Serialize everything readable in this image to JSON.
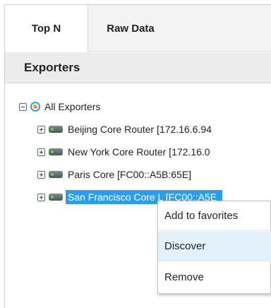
{
  "tabs": [
    {
      "label": "Top N",
      "active": true
    },
    {
      "label": "Raw Data",
      "active": false
    }
  ],
  "section": {
    "title": "Exporters"
  },
  "tree": {
    "root": {
      "label": "All Exporters",
      "expanded": true,
      "icon": "globe-icon"
    },
    "children": [
      {
        "label": "Beijing Core Router [172.16.6.94",
        "icon": "router-icon"
      },
      {
        "label": "New York Core Router [172.16.0",
        "icon": "router-icon"
      },
      {
        "label": "Paris Core [FC00::A5B:65E]",
        "icon": "router-icon"
      },
      {
        "label": "San Francisco Core L [FC00::A5E",
        "icon": "router-icon",
        "selected": true
      }
    ]
  },
  "context_menu": {
    "items": [
      {
        "label": "Add to favorites"
      },
      {
        "label": "Discover",
        "highlighted": true
      },
      {
        "label": "Remove"
      }
    ]
  },
  "colors": {
    "selection": "#2a9ee6",
    "menu_highlight": "#e3f1fb",
    "header_bg": "#ececec"
  }
}
